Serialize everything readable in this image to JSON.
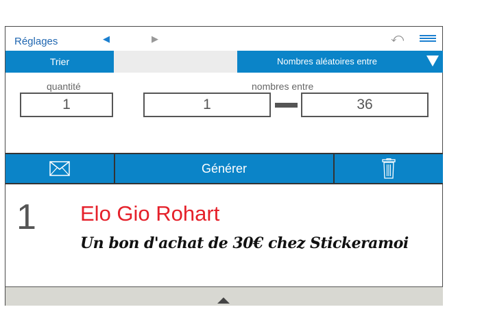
{
  "header": {
    "settings_label": "Réglages",
    "nav_prev_icon": "arrow-left-icon",
    "nav_next_icon": "arrow-right-icon",
    "undo_icon": "undo-icon",
    "menu_icon": "hamburger-menu-icon"
  },
  "toolbar": {
    "sort_label": "Trier",
    "mode_label": "Nombres aléatoires entre",
    "mode_icon": "dropdown-triangle-icon"
  },
  "form": {
    "quantity_caption": "quantité",
    "quantity_value": "1",
    "range_caption": "nombres entre",
    "range_min": "1",
    "range_max": "36"
  },
  "actions": {
    "email_icon": "envelope-icon",
    "generate_label": "Générer",
    "delete_icon": "trash-icon"
  },
  "result": {
    "number": "1",
    "name": "Elo Gio Rohart",
    "prize": "Un bon d'achat de 30€ chez Stickeramoi"
  },
  "footer": {
    "expand_icon": "triangle-up-icon"
  },
  "colors": {
    "accent": "#0b84c8",
    "winner_name": "#e5202a"
  }
}
